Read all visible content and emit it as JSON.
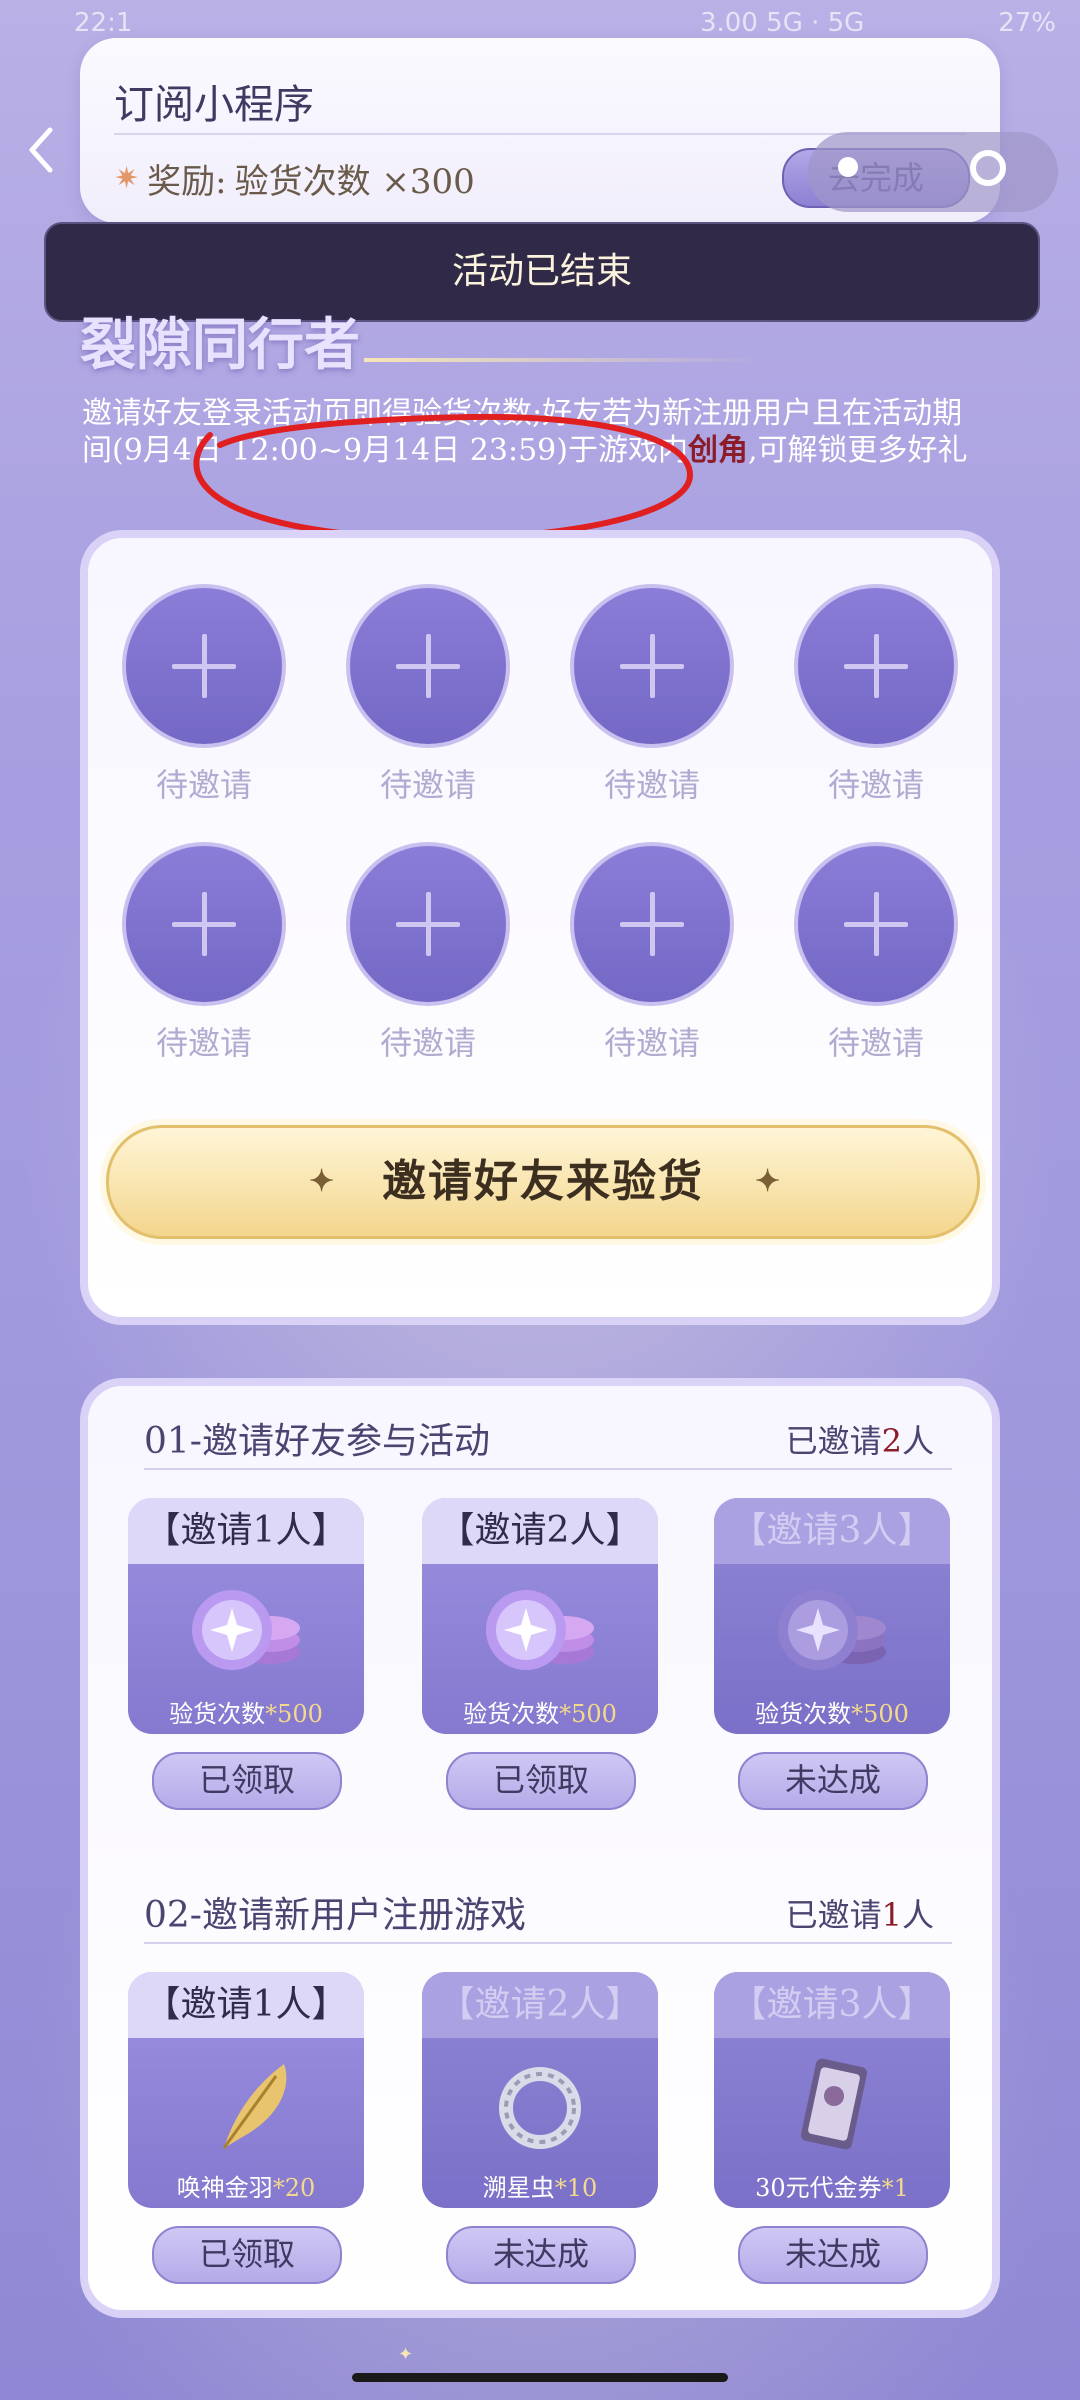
{
  "status_bar": {
    "time": "22:1",
    "network": "3.00 5G · 5G",
    "battery": "27%"
  },
  "subscribe_card": {
    "title": "订阅小程序",
    "reward_label": "奖励:",
    "reward_text": "验货次数 ×300",
    "go_button": "去完成"
  },
  "banner": {
    "ended_text": "活动已结束"
  },
  "event": {
    "title": "裂隙同行者",
    "desc_part1": "邀请好友登录活动页即得验货次数;好友若为新注册用户且在活动期间(9月4日 12:00~9月14日 23:59)于游戏内",
    "desc_highlight": "创角",
    "desc_part2": ",可解锁更多好礼"
  },
  "invite_slots": [
    {
      "label": "待邀请"
    },
    {
      "label": "待邀请"
    },
    {
      "label": "待邀请"
    },
    {
      "label": "待邀请"
    },
    {
      "label": "待邀请"
    },
    {
      "label": "待邀请"
    },
    {
      "label": "待邀请"
    },
    {
      "label": "待邀请"
    }
  ],
  "invite_button": {
    "label": "邀请好友来验货"
  },
  "section1": {
    "title": "01-邀请好友参与活动",
    "count_prefix": "已邀请",
    "count_num": "2",
    "count_suffix": "人",
    "rewards": [
      {
        "head": "【邀请1人】",
        "name": "验货次数",
        "qty": "*500",
        "state": "已领取",
        "icon": "coin-icon"
      },
      {
        "head": "【邀请2人】",
        "name": "验货次数",
        "qty": "*500",
        "state": "已领取",
        "icon": "coin-icon"
      },
      {
        "head": "【邀请3人】",
        "name": "验货次数",
        "qty": "*500",
        "state": "未达成",
        "icon": "coin-icon"
      }
    ]
  },
  "section2": {
    "title": "02-邀请新用户注册游戏",
    "count_prefix": "已邀请",
    "count_num": "1",
    "count_suffix": "人",
    "rewards": [
      {
        "head": "【邀请1人】",
        "name": "唤神金羽",
        "qty": "*20",
        "state": "已领取",
        "icon": "feather-icon"
      },
      {
        "head": "【邀请2人】",
        "name": "溯星虫",
        "qty": "*10",
        "state": "未达成",
        "icon": "ring-icon"
      },
      {
        "head": "【邀请3人】",
        "name": "30元代金券",
        "qty": "*1",
        "state": "未达成",
        "icon": "voucher-icon"
      }
    ]
  },
  "colors": {
    "accent_red": "#8b1d2a",
    "annotation_red": "#e02020",
    "gold": "#f3d68d"
  }
}
